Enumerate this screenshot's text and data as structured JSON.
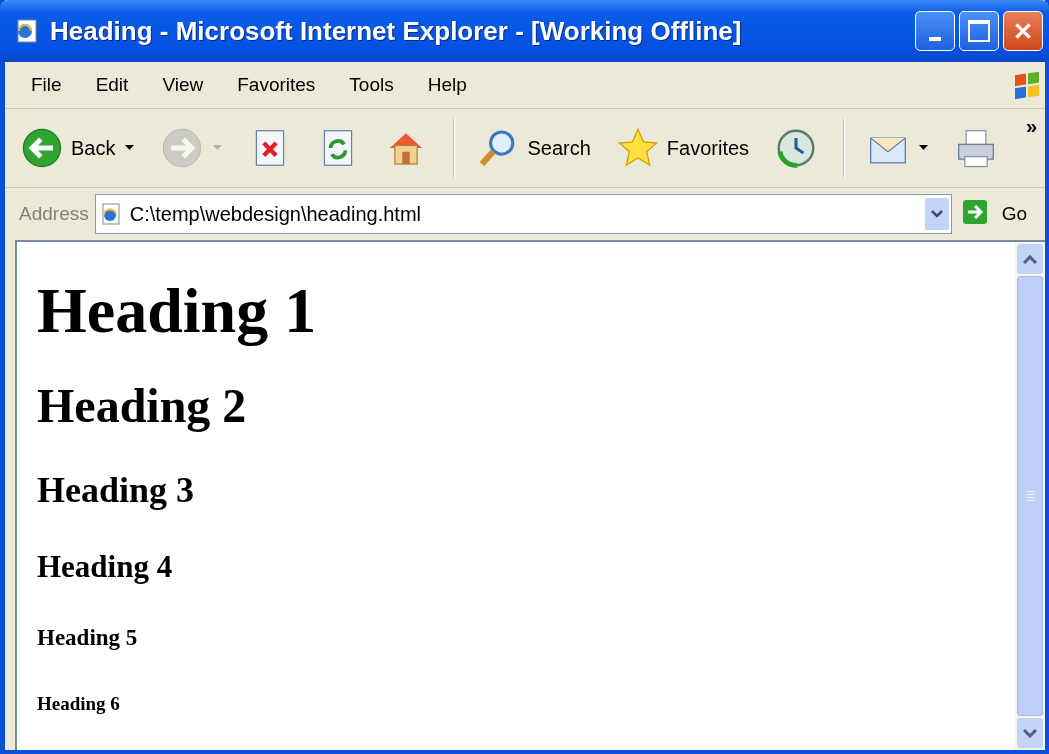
{
  "window": {
    "title": "Heading - Microsoft Internet Explorer - [Working Offline]"
  },
  "menu": [
    "File",
    "Edit",
    "View",
    "Favorites",
    "Tools",
    "Help"
  ],
  "toolbar": [
    {
      "kind": "back",
      "label": "Back",
      "dropdown": true,
      "disabled": false
    },
    {
      "kind": "forward",
      "dropdown": true,
      "disabled": true
    },
    {
      "kind": "stop",
      "disabled": false
    },
    {
      "kind": "refresh",
      "disabled": false
    },
    {
      "kind": "home",
      "disabled": false
    },
    {
      "kind": "separator"
    },
    {
      "kind": "search",
      "label": "Search",
      "disabled": false
    },
    {
      "kind": "favorites",
      "label": "Favorites",
      "disabled": false
    },
    {
      "kind": "history",
      "disabled": false
    },
    {
      "kind": "separator"
    },
    {
      "kind": "mail",
      "dropdown": true,
      "disabled": false
    },
    {
      "kind": "print",
      "disabled": false
    }
  ],
  "toolbar_overflow": "»",
  "address_bar": {
    "label": "Address",
    "value": "C:\\temp\\webdesign\\heading.html",
    "go_label": "Go"
  },
  "page": {
    "headings": [
      {
        "kind": "h1",
        "text": "Heading 1"
      },
      {
        "kind": "h2",
        "text": "Heading 2"
      },
      {
        "kind": "h3",
        "text": "Heading 3"
      },
      {
        "kind": "h4",
        "text": "Heading 4"
      },
      {
        "kind": "h5",
        "text": "Heading 5"
      },
      {
        "kind": "h6",
        "text": "Heading 6"
      }
    ]
  }
}
